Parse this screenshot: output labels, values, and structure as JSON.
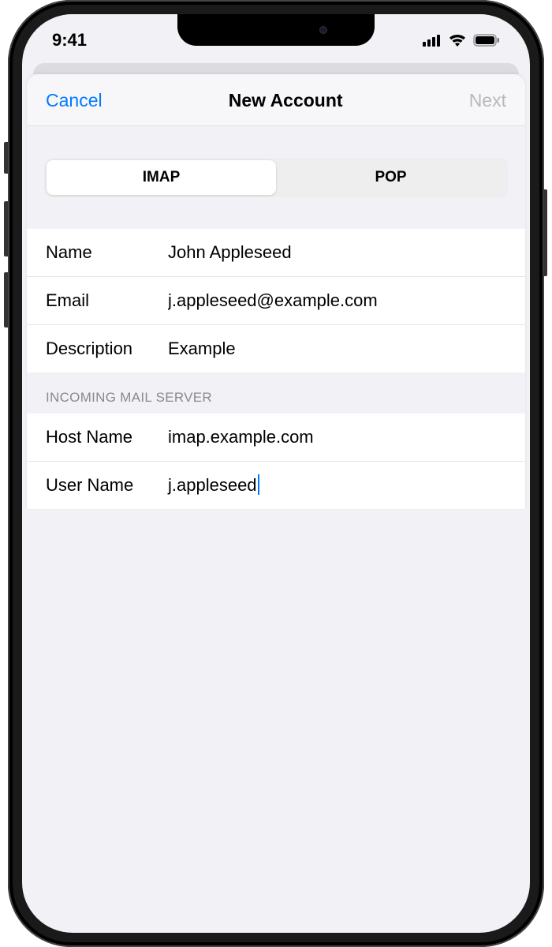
{
  "status": {
    "time": "9:41"
  },
  "nav": {
    "cancel": "Cancel",
    "title": "New Account",
    "next": "Next"
  },
  "segmented": {
    "imap": "IMAP",
    "pop": "POP"
  },
  "account": {
    "name_label": "Name",
    "name_value": "John Appleseed",
    "email_label": "Email",
    "email_value": "j.appleseed@example.com",
    "desc_label": "Description",
    "desc_value": "Example"
  },
  "incoming": {
    "header": "INCOMING MAIL SERVER",
    "host_label": "Host Name",
    "host_value": "imap.example.com",
    "user_label": "User Name",
    "user_value": "j.appleseed"
  }
}
